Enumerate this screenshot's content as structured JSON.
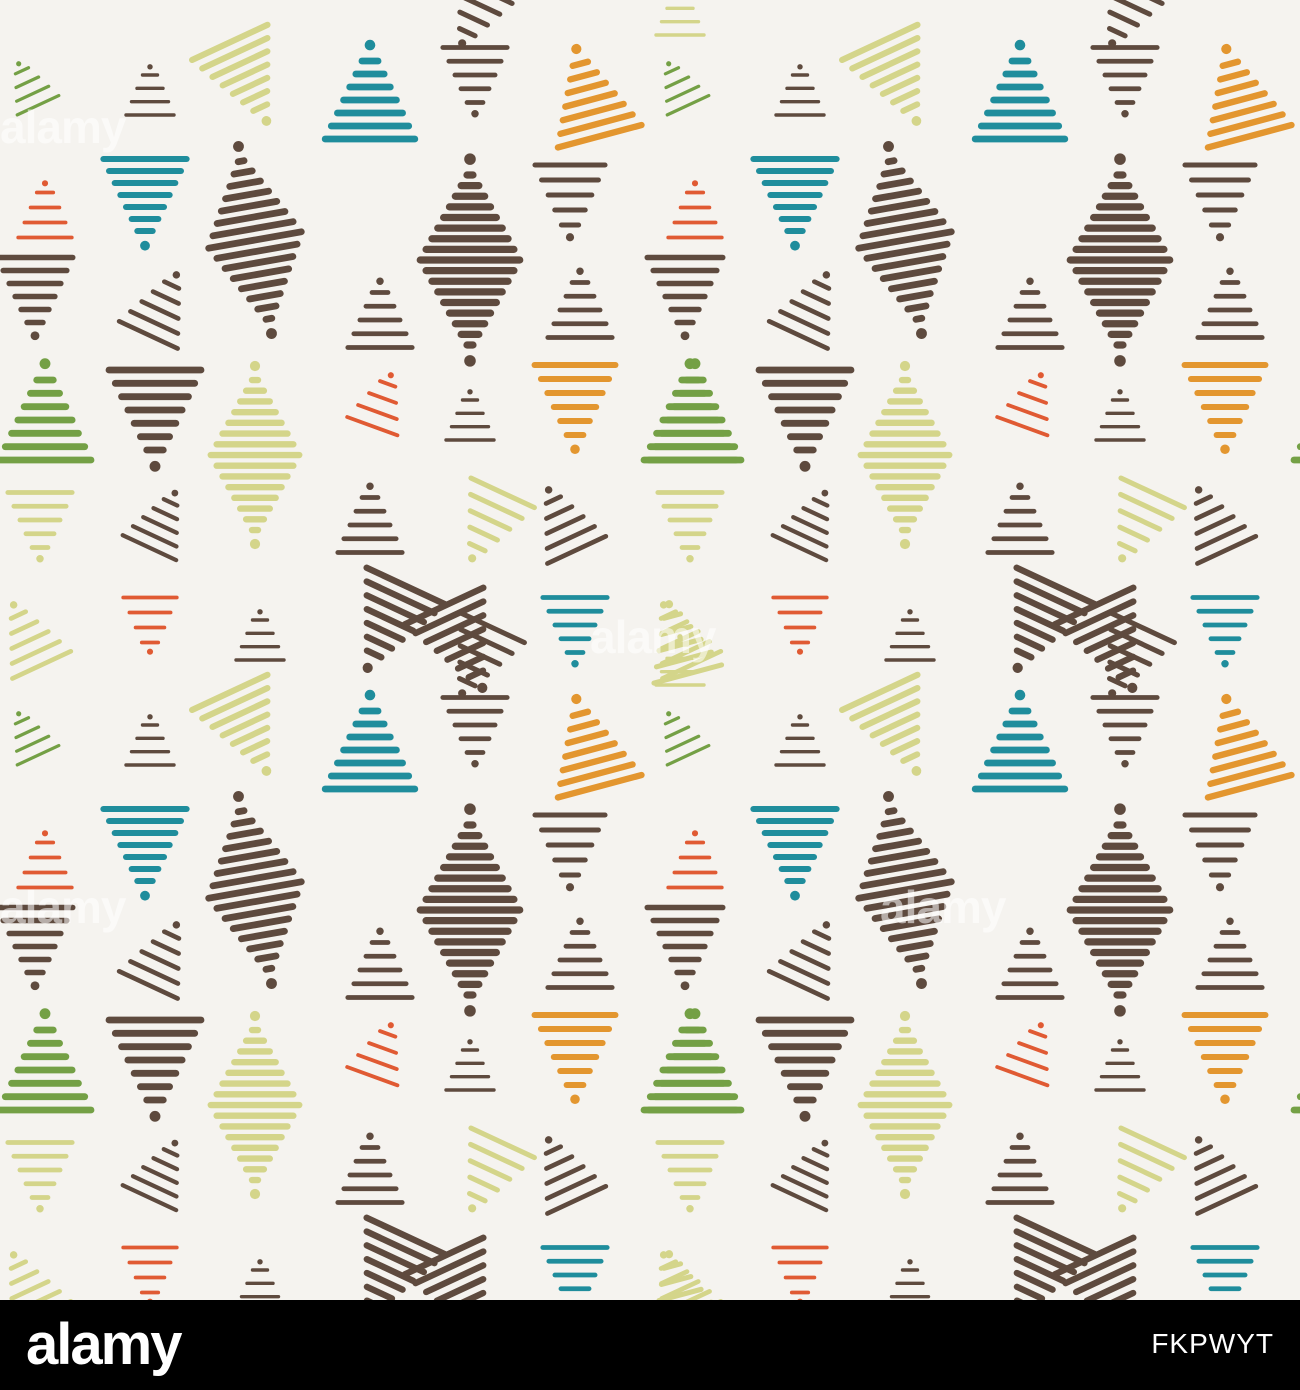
{
  "pattern": {
    "background": "#f5f3ef",
    "palette": {
      "brown": "#5e4a3e",
      "teal": "#1f8d9c",
      "orange": "#e3962f",
      "red": "#e05a33",
      "green": "#74a045",
      "lime": "#d4d58a"
    }
  },
  "watermark": {
    "text": "alamy"
  },
  "footer": {
    "logo": "alamy",
    "image_id": "FKPWYT",
    "background": "#000000",
    "text_color": "#ffffff"
  }
}
